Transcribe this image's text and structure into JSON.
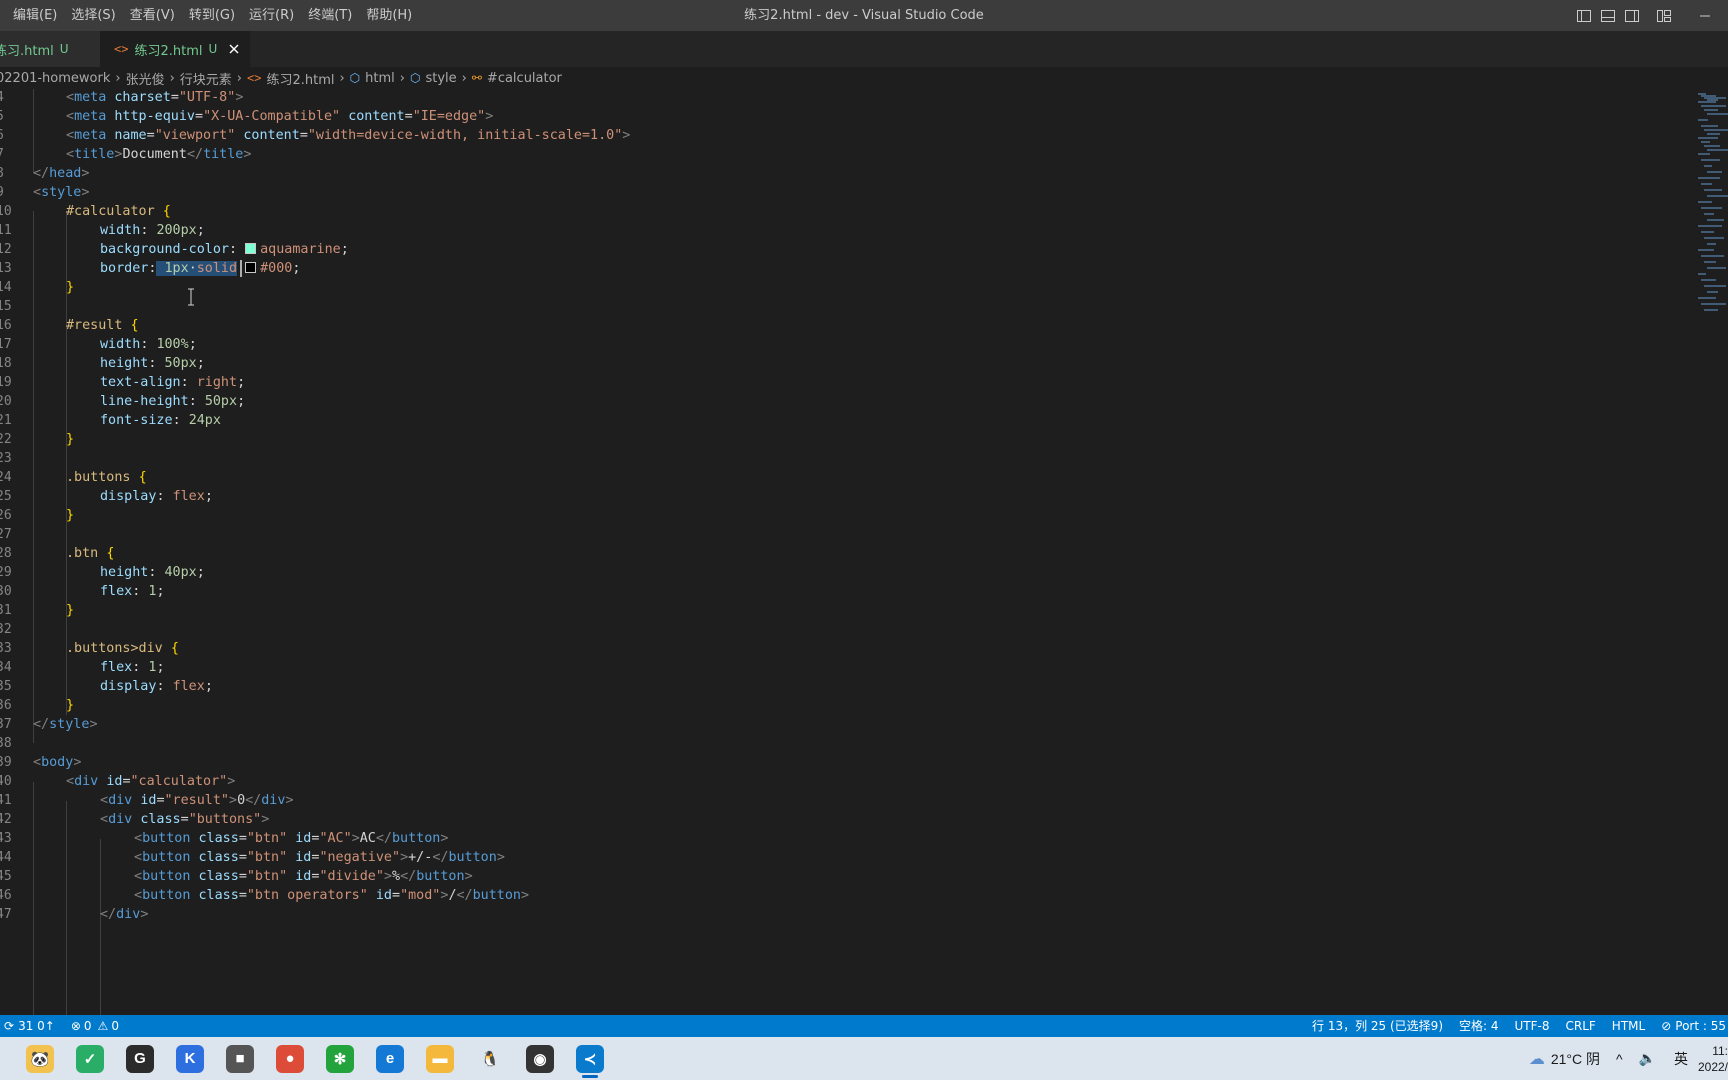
{
  "titlebar": {
    "menu": [
      "编辑(E)",
      "选择(S)",
      "查看(V)",
      "转到(G)",
      "运行(R)",
      "终端(T)",
      "帮助(H)"
    ],
    "window_title": "练习2.html - dev - Visual Studio Code"
  },
  "tabs": [
    {
      "label": "练习.html",
      "badge": "U",
      "active": false
    },
    {
      "label": "练习2.html",
      "badge": "U",
      "active": true
    }
  ],
  "breadcrumbs": [
    "02201-homework",
    "张光俊",
    "行块元素",
    "练习2.html",
    "html",
    "style",
    "#calculator"
  ],
  "editor": {
    "line_numbers": [
      "4",
      "5",
      "6",
      "7",
      "8",
      "9",
      "10",
      "11",
      "12",
      "13",
      "14",
      "15",
      "16",
      "17",
      "18",
      "19",
      "20",
      "21",
      "22",
      "23",
      "24",
      "25",
      "26",
      "27",
      "28",
      "29",
      "30",
      "31",
      "32",
      "33",
      "34",
      "35",
      "36",
      "37",
      "38",
      "39",
      "40",
      "41",
      "42",
      "43",
      "44",
      "45",
      "46",
      "47"
    ],
    "tokens": {
      "meta": "meta",
      "charset": "charset",
      "utf8": "\"UTF-8\"",
      "http_equiv": "http-equiv",
      "xua": "\"X-UA-Compatible\"",
      "content": "content",
      "ie_edge": "\"IE=edge\"",
      "name": "name",
      "viewport": "\"viewport\"",
      "viewport_content": "\"width=device-width, initial-scale=1.0\"",
      "title": "title",
      "document": "Document",
      "head": "head",
      "style": "style",
      "sel_calculator": "#calculator",
      "sel_result": "#result",
      "sel_buttons": ".buttons",
      "sel_btn": ".btn",
      "sel_buttons_div": ".buttons>div",
      "width": "width",
      "height": "height",
      "background_color": "background-color",
      "border": "border",
      "text_align": "text-align",
      "line_height": "line-height",
      "font_size": "font-size",
      "display": "display",
      "flex": "flex",
      "v200px": "200px",
      "aquamarine": "aquamarine",
      "v1px": "1px",
      "solid": "solid",
      "c000": "#000",
      "v100": "100%",
      "v50px": "50px",
      "right": "right",
      "v24px": "24px",
      "flexv": "flex",
      "v40px": "40px",
      "v1": "1",
      "body": "body",
      "div": "div",
      "id": "id",
      "class": "class",
      "button": "button",
      "calculator_str": "\"calculator\"",
      "result_str": "\"result\"",
      "zero": "0",
      "buttons_str": "\"buttons\"",
      "btn_str": "\"btn\"",
      "ac_str": "\"AC\"",
      "ac": "AC",
      "negative_str": "\"negative\"",
      "plusminus": "+/-",
      "divide_str": "\"divide\"",
      "percent": "%",
      "btn_operators_str": "\"btn operators\"",
      "mod_str": "\"mod\"",
      "slash": "/"
    },
    "colors": {
      "aquamarine": "#7fffd4",
      "black": "#000000"
    }
  },
  "statusbar": {
    "sync": "31 0↑",
    "errors": "0",
    "warnings": "0",
    "cursor": "行 13，列 25 (已选择9)",
    "spaces": "空格: 4",
    "encoding": "UTF-8",
    "eol": "CRLF",
    "language": "HTML",
    "port": "Port : 55"
  },
  "taskbar": {
    "apps": [
      {
        "icon": "panda-app-icon",
        "glyph": "🐼",
        "bg": "#f2c14e"
      },
      {
        "icon": "wechat-icon",
        "glyph": "✓",
        "bg": "#2aae67"
      },
      {
        "icon": "g-app-icon",
        "glyph": "G",
        "bg": "#2b2b2b"
      },
      {
        "icon": "k-app-icon",
        "glyph": "K",
        "bg": "#2e6fe0"
      },
      {
        "icon": "photo-app-icon",
        "glyph": "■",
        "bg": "#555555"
      },
      {
        "icon": "chrome-icon",
        "glyph": "●",
        "bg": "#dd4b39"
      },
      {
        "icon": "xmind-icon",
        "glyph": "✻",
        "bg": "#23a33b"
      },
      {
        "icon": "edge-icon",
        "glyph": "e",
        "bg": "#1479d4"
      },
      {
        "icon": "folder-icon",
        "glyph": "▬",
        "bg": "#f4b93c"
      },
      {
        "icon": "qq-icon",
        "glyph": "🐧",
        "bg": "#dce4ee"
      },
      {
        "icon": "obs-icon",
        "glyph": "◉",
        "bg": "#333333"
      },
      {
        "icon": "vscode-icon",
        "glyph": "≺",
        "bg": "#0a7acc",
        "active": true
      }
    ],
    "weather": "21°C  阴",
    "ime": "英",
    "time": "11:",
    "date": "2022/"
  }
}
